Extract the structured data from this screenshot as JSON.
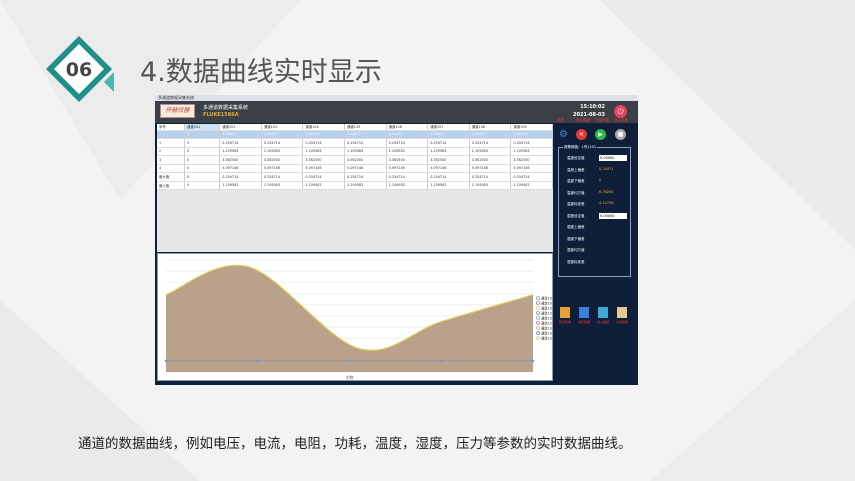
{
  "slide": {
    "badge_number": "06",
    "title": "4.数据曲线实时显示",
    "caption": "通道的数据曲线，例如电压，电流，电阻，功耗，温度，湿度，压力等参数的实时数据曲线。"
  },
  "app": {
    "window_title": "多通道数据采集系统",
    "logo_text": "仟赫仪器",
    "app_name": "多通道数据采集系统",
    "model": "FLUKE1586A",
    "time": "15:10:02",
    "date": "2021-08-03"
  },
  "table": {
    "headers": [
      "序号",
      "通道101",
      "通道102",
      "通道103",
      "通道104",
      "通道105",
      "通道106",
      "通道107",
      "通道108",
      "通道109"
    ],
    "rows": [
      [
        "",
        "0",
        "1.35471",
        "1.35471",
        "1.35471",
        "1.35471",
        "1.35471",
        "1.35471",
        "1.35471",
        "1.35471"
      ],
      [
        "1",
        "0",
        "0.254714",
        "0.254714",
        "0.254714",
        "0.254714",
        "0.254714",
        "0.254714",
        "0.254714",
        "0.254714"
      ],
      [
        "2",
        "0",
        "1.109583",
        "1.109583",
        "1.109583",
        "1.109583",
        "1.109583",
        "1.109583",
        "1.109583",
        "1.109583"
      ],
      [
        "3",
        "0",
        "3.562500",
        "3.562500",
        "3.562500",
        "3.562500",
        "3.562500",
        "3.562500",
        "3.562500",
        "3.562500"
      ],
      [
        "4",
        "0",
        "5.097146",
        "5.097146",
        "5.097146",
        "5.097146",
        "5.097146",
        "5.097146",
        "5.097146",
        "5.097146"
      ],
      [
        "最大值",
        "0",
        "0.254714",
        "0.254714",
        "0.254714",
        "0.254714",
        "0.254714",
        "0.254714",
        "0.254714",
        "0.254714"
      ],
      [
        "最小值",
        "0",
        "1.109583",
        "1.109583",
        "1.109583",
        "1.109583",
        "1.109583",
        "1.109583",
        "1.109583",
        "1.109583"
      ]
    ]
  },
  "panel": {
    "actions": [
      "设置",
      "清空数据",
      "开始采集",
      "停止采集"
    ],
    "group_title": "报警阈值：1号1101",
    "fields": [
      {
        "label": "温度设定值",
        "value": "0.00000",
        "input": true
      },
      {
        "label": "温度上偏差",
        "value": "0.25471"
      },
      {
        "label": "温度下偏差",
        "value": "0"
      },
      {
        "label": "温度均方值",
        "value": "6.36265"
      },
      {
        "label": "温度标准差",
        "value": "4.12736"
      },
      {
        "label": "湿度设定值",
        "value": "0.00000",
        "input": true
      },
      {
        "label": "湿度上偏差",
        "value": ""
      },
      {
        "label": "湿度下偏差",
        "value": ""
      },
      {
        "label": "湿度均方值",
        "value": ""
      },
      {
        "label": "湿度标准差",
        "value": ""
      }
    ],
    "bottom_buttons": [
      "导出数据",
      "保存数据",
      "导入数据",
      "生成报告"
    ]
  },
  "chart_data": {
    "type": "area",
    "x": [
      0,
      0.9,
      2.1,
      3,
      4
    ],
    "values": [
      5.9,
      8.4,
      1.1,
      3.5,
      5.9
    ],
    "baseline": 0,
    "ylim": [
      -1,
      9
    ],
    "xlim": [
      0,
      4
    ],
    "xlabel": "次数",
    "fill": "#b9a18a",
    "line": "#e0d060",
    "legend": [
      "通道101",
      "通道102",
      "通道103",
      "通道104",
      "通道105",
      "通道106",
      "通道107",
      "通道108",
      "通道109"
    ],
    "legend_colors": [
      "#3a8fd0",
      "#d04040",
      "#e0c040",
      "#5a6a7a",
      "#30b0c0",
      "#c03070",
      "#e08040",
      "#4050a0",
      "#c0c040"
    ],
    "legend_placement": "right"
  }
}
